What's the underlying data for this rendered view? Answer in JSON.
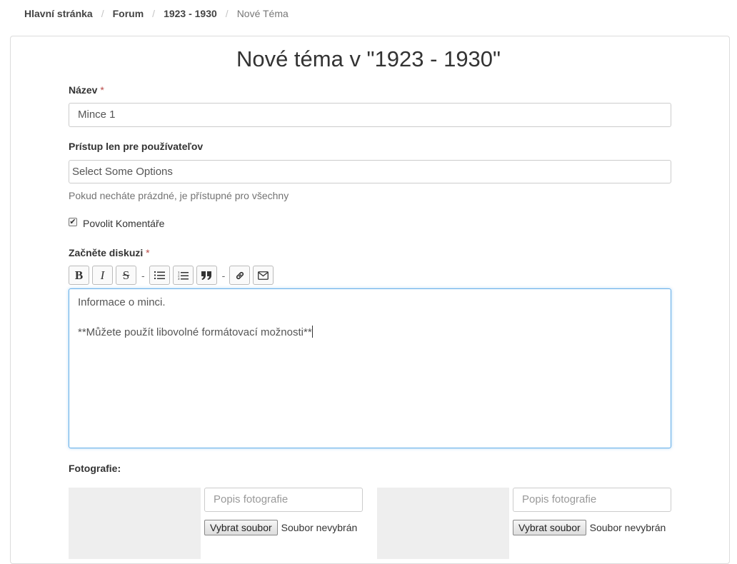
{
  "breadcrumb": [
    "Hlavní stránka",
    "Forum",
    "1923 - 1930",
    "Nové Téma"
  ],
  "title": "Nové téma v \"1923 - 1930\"",
  "form": {
    "name_label": "Název",
    "required_mark": "*",
    "name_value": "Mince 1",
    "access_label": "Prístup len pre používateľov",
    "access_placeholder": "Select Some Options",
    "access_help": "Pokud necháte prázdné, je přístupné pro všechny",
    "comments_label": "Povolit Komentáře",
    "comments_checked": true,
    "discussion_label": "Začněte diskuzi",
    "editor_lines": [
      "Informace o minci.",
      "",
      "**Můžete použít libovolné formátovací možnosti**"
    ],
    "photos_label": "Fotografie:"
  },
  "toolbar": {
    "bold": "B",
    "italic": "I",
    "strike": "S",
    "separator": "-",
    "icons": [
      "bold-icon",
      "italic-icon",
      "strikethrough-icon",
      "bullet-list-icon",
      "numbered-list-icon",
      "quote-icon",
      "link-icon",
      "email-icon"
    ]
  },
  "photos": [
    {
      "desc_placeholder": "Popis fotografie",
      "file_button": "Vybrat soubor",
      "file_status": "Soubor nevybrán"
    },
    {
      "desc_placeholder": "Popis fotografie",
      "file_button": "Vybrat soubor",
      "file_status": "Soubor nevybrán"
    }
  ],
  "colors": {
    "required": "#b94a48",
    "focus_border": "#66afe9",
    "photo_placeholder_bg": "#eeeeee"
  }
}
